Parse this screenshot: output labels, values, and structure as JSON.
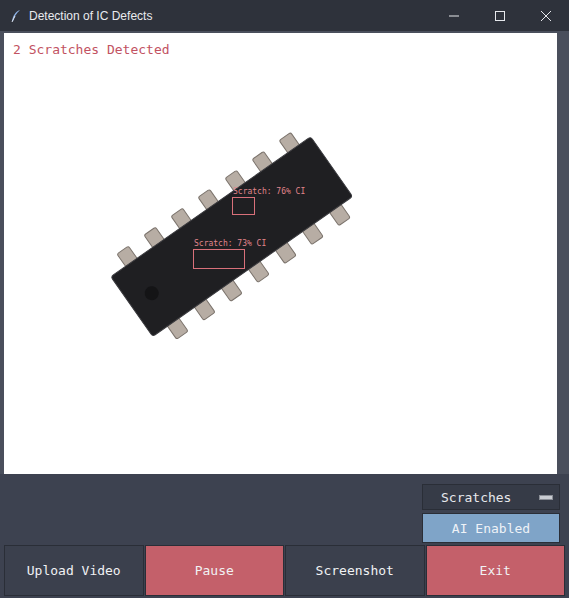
{
  "window": {
    "title": "Detection of IC Defects"
  },
  "video": {
    "status": "2 Scratches Detected",
    "detections": [
      {
        "label": "Scratch: 76% CI"
      },
      {
        "label": "Scratch: 73% CI"
      }
    ]
  },
  "defect_selector": {
    "value": "Scratches"
  },
  "ai_toggle": {
    "label": "AI Enabled",
    "on": true
  },
  "buttons": [
    {
      "label": "Upload Video",
      "color": "#3b404d"
    },
    {
      "label": "Pause",
      "color": "#c4606a"
    },
    {
      "label": "Screenshot",
      "color": "#3b404d"
    },
    {
      "label": "Exit",
      "color": "#c4606a"
    }
  ]
}
